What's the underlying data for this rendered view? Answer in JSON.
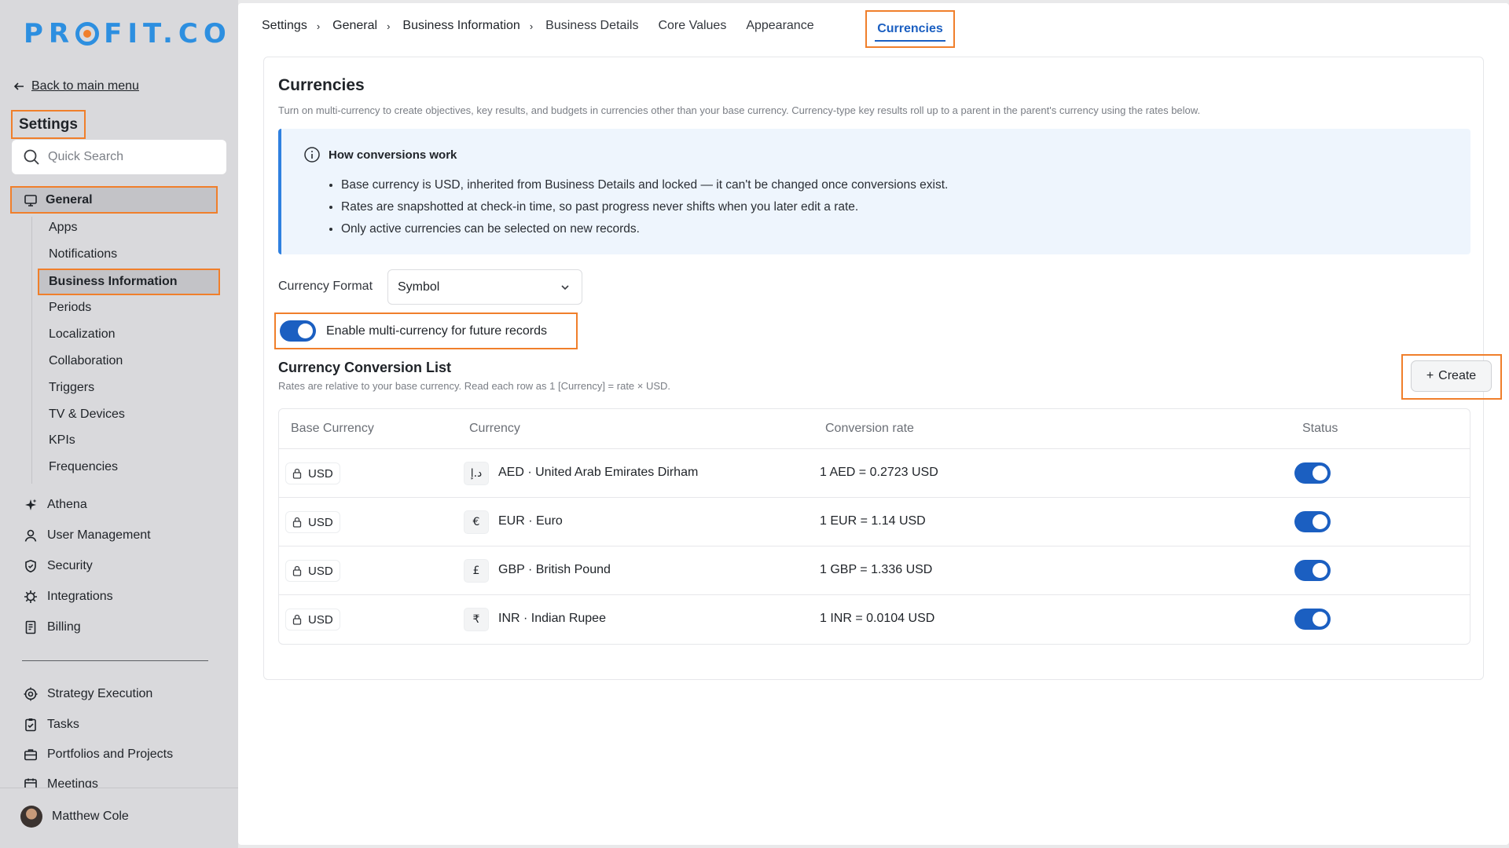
{
  "sidebar": {
    "logo_text_a": "PR",
    "logo_text_b": "FIT.CO",
    "back_label": "Back to main menu",
    "settings_title": "Settings",
    "search_placeholder": "Quick Search",
    "general_label": "General",
    "sub_items": [
      "Apps",
      "Notifications",
      "Business Information",
      "Periods",
      "Localization",
      "Collaboration",
      "Triggers",
      "TV & Devices",
      "KPIs",
      "Frequencies"
    ],
    "main_items": [
      {
        "label": "Athena",
        "icon": "sparkle-icon"
      },
      {
        "label": "User Management",
        "icon": "user-icon"
      },
      {
        "label": "Security",
        "icon": "shield-icon"
      },
      {
        "label": "Integrations",
        "icon": "plug-icon"
      },
      {
        "label": "Billing",
        "icon": "receipt-icon"
      }
    ],
    "lower_items": [
      {
        "label": "Strategy Execution",
        "icon": "target-icon"
      },
      {
        "label": "Tasks",
        "icon": "clipboard-icon"
      },
      {
        "label": "Portfolios and Projects",
        "icon": "briefcase-icon"
      },
      {
        "label": "Meetings",
        "icon": "calendar-icon"
      }
    ],
    "user_name": "Matthew Cole"
  },
  "breadcrumb": {
    "items": [
      "Settings",
      "General",
      "Business Information"
    ],
    "tabs": [
      "Business Details",
      "Core Values",
      "Appearance"
    ],
    "active_tab": "Currencies"
  },
  "currencies": {
    "title": "Currencies",
    "subtitle": "Turn on multi-currency to create objectives, key results, and budgets in currencies other than your base currency. Currency-type key results roll up to a parent in the parent's currency using the rates below.",
    "info_title": "How conversions work",
    "info_points": [
      "Base currency is USD, inherited from Business Details and locked — it can't be changed once conversions exist.",
      "Rates are snapshotted at check-in time, so past progress never shifts when you later edit a rate.",
      "Only active currencies can be selected on new records."
    ],
    "format_label": "Currency Format",
    "format_value": "Symbol",
    "multi_toggle_label": "Enable multi-currency for future records",
    "multi_toggle_on": true,
    "list_title": "Currency Conversion List",
    "list_subtitle": "Rates are relative to your base currency. Read each row as 1 [Currency] = rate × USD.",
    "create_label": "Create",
    "columns": [
      "Base Currency",
      "Currency",
      "Conversion rate",
      "Status"
    ],
    "rows": [
      {
        "base": "USD",
        "symbol": "د.إ",
        "currency": "AED · United Arab Emirates Dirham",
        "rate": "1 AED = 0.2723 USD",
        "active": true
      },
      {
        "base": "USD",
        "symbol": "€",
        "currency": "EUR · Euro",
        "rate": "1 EUR = 1.14 USD",
        "active": true
      },
      {
        "base": "USD",
        "symbol": "£",
        "currency": "GBP · British Pound",
        "rate": "1 GBP = 1.336 USD",
        "active": true
      },
      {
        "base": "USD",
        "symbol": "₹",
        "currency": "INR · Indian Rupee",
        "rate": "1 INR = 0.0104 USD",
        "active": true
      }
    ]
  },
  "colors": {
    "accent": "#1b5fc1",
    "highlight_border": "#f07f2b",
    "logo_blue": "#2d8fe0"
  }
}
